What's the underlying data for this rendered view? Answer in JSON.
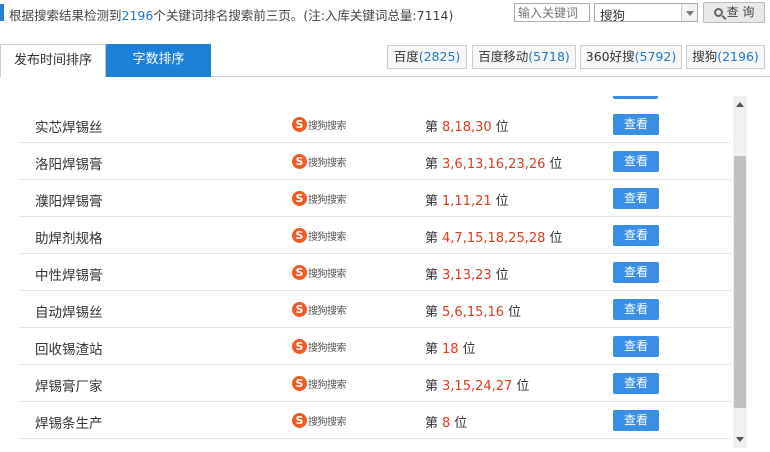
{
  "header": {
    "summary_prefix": "根据搜索结果检测到",
    "keyword_count": "2196",
    "summary_suffix": "个关键词排名搜索前三页。(注:入库关键词总量:7114)",
    "keyword_input_placeholder": "输入关键词",
    "engine_selected": "搜狗",
    "query_button": "查 询"
  },
  "tabs": [
    {
      "label": "发布时间排序",
      "active": false
    },
    {
      "label": "字数排序",
      "active": true
    }
  ],
  "engines": [
    {
      "name": "百度",
      "count": "(2825)"
    },
    {
      "name": "百度移动",
      "count": "(5718)"
    },
    {
      "name": "360好搜",
      "count": "(5792)"
    },
    {
      "name": "搜狗",
      "count": "(2196)"
    }
  ],
  "colors": {
    "accent": "#1c81d6",
    "rank": "#e03a1e",
    "sogou": "#f15a22"
  },
  "rank_prefix": "第",
  "rank_suffix": "位",
  "sogou_logo_text": "搜狗搜索",
  "view_label": "查看",
  "rows": [
    {
      "keyword": "实芯焊锡丝",
      "ranks": "8,18,30"
    },
    {
      "keyword": "洛阳焊锡膏",
      "ranks": "3,6,13,16,23,26"
    },
    {
      "keyword": "濮阳焊锡膏",
      "ranks": "1,11,21"
    },
    {
      "keyword": "助焊剂规格",
      "ranks": "4,7,15,18,25,28"
    },
    {
      "keyword": "中性焊锡膏",
      "ranks": "3,13,23"
    },
    {
      "keyword": "自动焊锡丝",
      "ranks": "5,6,15,16"
    },
    {
      "keyword": "回收锡渣站",
      "ranks": "18"
    },
    {
      "keyword": "焊锡膏厂家",
      "ranks": "3,15,24,27"
    },
    {
      "keyword": "焊锡条生产",
      "ranks": "8"
    }
  ]
}
